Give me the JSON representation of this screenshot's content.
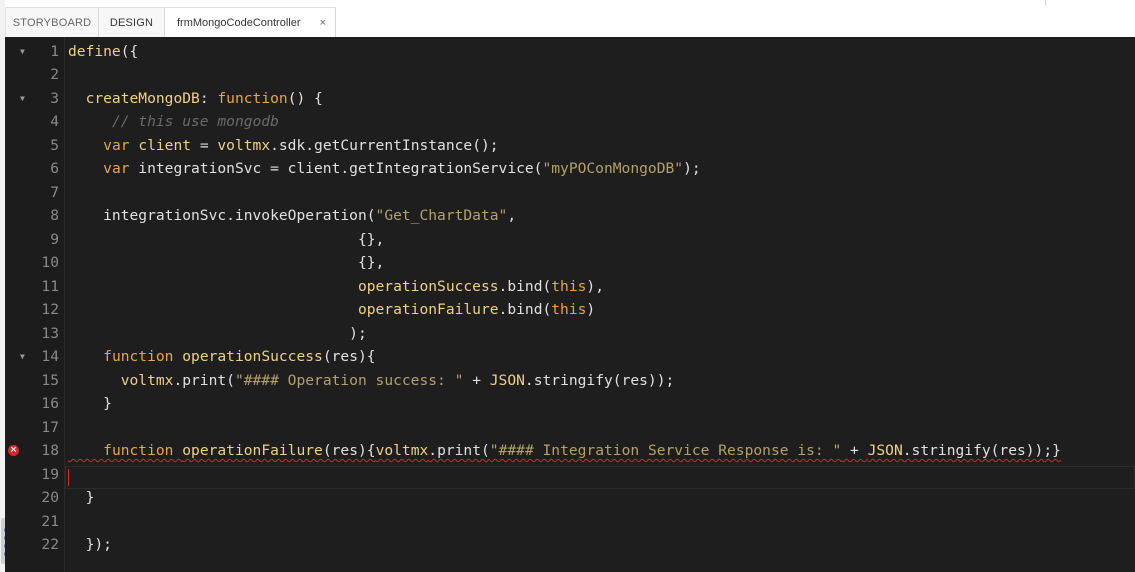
{
  "tabs": [
    {
      "label": "STORYBOARD"
    },
    {
      "label": "DESIGN"
    },
    {
      "label": "frmMongoCodeController",
      "close": "×"
    }
  ],
  "editor": {
    "lines": [
      {
        "n": "1",
        "fold": true,
        "tokens": [
          [
            "fn",
            "define"
          ],
          [
            "",
            "({"
          ]
        ]
      },
      {
        "n": "2",
        "tokens": []
      },
      {
        "n": "3",
        "fold": true,
        "tokens": [
          [
            "",
            "  "
          ],
          [
            "fn",
            "createMongoDB"
          ],
          [
            "",
            ": "
          ],
          [
            "kw",
            "function"
          ],
          [
            "",
            "() {"
          ]
        ]
      },
      {
        "n": "4",
        "tokens": [
          [
            "",
            "     "
          ],
          [
            "cm",
            "// this use mongodb"
          ]
        ]
      },
      {
        "n": "5",
        "tokens": [
          [
            "",
            "    "
          ],
          [
            "kw",
            "var"
          ],
          [
            "",
            " "
          ],
          [
            "fn",
            "client"
          ],
          [
            "",
            " = "
          ],
          [
            "fn",
            "voltmx"
          ],
          [
            "",
            ".sdk.getCurrentInstance();"
          ]
        ]
      },
      {
        "n": "6",
        "tokens": [
          [
            "",
            "    "
          ],
          [
            "kw",
            "var"
          ],
          [
            "",
            " integrationSvc = client.getIntegrationService("
          ],
          [
            "str",
            "\"myPOConMongoDB\""
          ],
          [
            "",
            ");"
          ]
        ]
      },
      {
        "n": "7",
        "tokens": []
      },
      {
        "n": "8",
        "tokens": [
          [
            "",
            "    integrationSvc.invokeOperation("
          ],
          [
            "str",
            "\"Get_ChartData\""
          ],
          [
            "",
            ","
          ]
        ]
      },
      {
        "n": "9",
        "tokens": [
          [
            "",
            "                                 {},"
          ]
        ]
      },
      {
        "n": "10",
        "tokens": [
          [
            "",
            "                                 {},"
          ]
        ]
      },
      {
        "n": "11",
        "tokens": [
          [
            "",
            "                                 "
          ],
          [
            "fn",
            "operationSuccess"
          ],
          [
            "",
            ".bind("
          ],
          [
            "kw",
            "this"
          ],
          [
            "",
            "),"
          ]
        ]
      },
      {
        "n": "12",
        "tokens": [
          [
            "",
            "                                 "
          ],
          [
            "fn",
            "operationFailure"
          ],
          [
            "",
            ".bind("
          ],
          [
            "kw",
            "this"
          ],
          [
            "",
            ")"
          ]
        ]
      },
      {
        "n": "13",
        "tokens": [
          [
            "",
            "                                );"
          ]
        ]
      },
      {
        "n": "14",
        "fold": true,
        "tokens": [
          [
            "",
            "    "
          ],
          [
            "kw",
            "function"
          ],
          [
            "",
            " "
          ],
          [
            "fn",
            "operationSuccess"
          ],
          [
            "",
            "(res){"
          ]
        ]
      },
      {
        "n": "15",
        "tokens": [
          [
            "",
            "      "
          ],
          [
            "fn",
            "voltmx"
          ],
          [
            "",
            ".print("
          ],
          [
            "str",
            "\"#### Operation success: \""
          ],
          [
            "",
            " + "
          ],
          [
            "fn",
            "JSON"
          ],
          [
            "",
            ".stringify(res));"
          ]
        ]
      },
      {
        "n": "16",
        "tokens": [
          [
            "",
            "    }"
          ]
        ]
      },
      {
        "n": "17",
        "tokens": []
      },
      {
        "n": "18",
        "error": true,
        "squiggle": true,
        "tokens": [
          [
            "",
            "    "
          ],
          [
            "kw",
            "function"
          ],
          [
            "",
            " "
          ],
          [
            "fn",
            "operationFailure"
          ],
          [
            "",
            "(res){"
          ],
          [
            "fn",
            "voltmx"
          ],
          [
            "",
            ".print("
          ],
          [
            "str",
            "\"#### Integration Service Response is: \""
          ],
          [
            "",
            " + "
          ],
          [
            "fn",
            "JSON"
          ],
          [
            "",
            ".stringify(res));}"
          ]
        ]
      },
      {
        "n": "19",
        "tokens": []
      },
      {
        "n": "20",
        "tokens": [
          [
            "",
            "  }"
          ]
        ]
      },
      {
        "n": "21",
        "tokens": []
      },
      {
        "n": "22",
        "tokens": [
          [
            "",
            "  });"
          ]
        ]
      }
    ]
  },
  "icons": {
    "fold": "triangle-down-icon",
    "error": "error-circle-icon",
    "grip": "drag-grip-icon"
  },
  "colors": {
    "background": "#1e1e1e",
    "keyword": "#e8a54b",
    "function": "#eed089",
    "string": "#b5a06a",
    "comment": "#6a6a6a",
    "error": "#d22b2b"
  }
}
